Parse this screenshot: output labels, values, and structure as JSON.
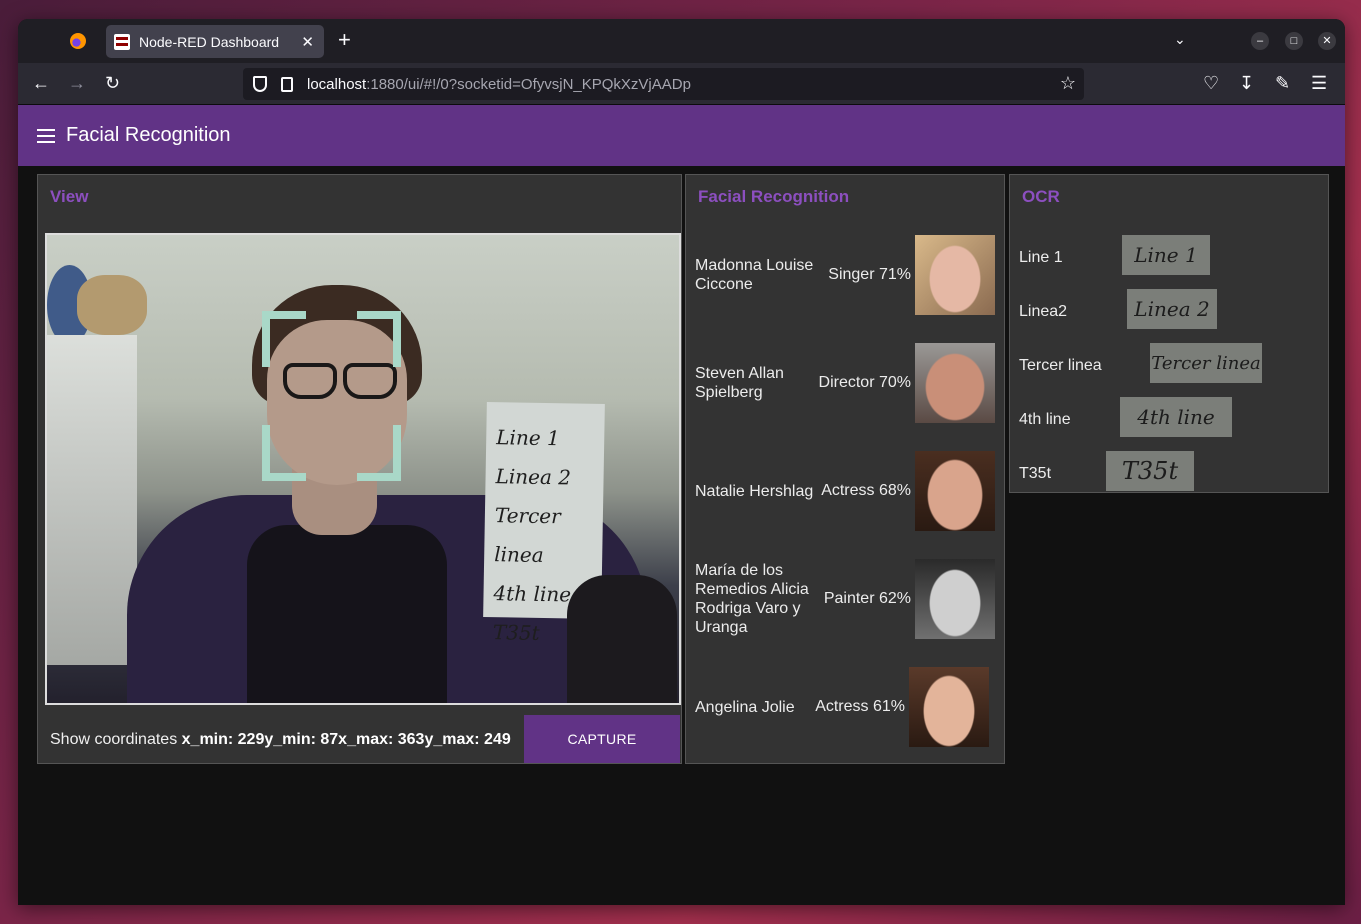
{
  "browser": {
    "tab_title": "Node-RED Dashboard",
    "tab_close": "✕",
    "new_tab": "+",
    "url_host": "localhost",
    "url_rest": ":1880/ui/#!/0?socketid=OfyvsjN_KPQkXzVjAADp"
  },
  "app": {
    "title": "Facial Recognition"
  },
  "view_card": {
    "title": "View",
    "paper_lines": [
      "Line 1",
      "Linea 2",
      "Tercer linea",
      "4th line",
      "T35t"
    ],
    "coords_label": "Show coordinates ",
    "coords_value": "x_min: 229y_min: 87x_max: 363y_max: 249",
    "capture_label": "CAPTURE"
  },
  "face_card": {
    "title": "Facial Recognition",
    "matches": [
      {
        "name": "Madonna Louise Ciccone",
        "role_pct": "Singer 71%",
        "skin": "#e5b8a5",
        "hair": "#d9b98a"
      },
      {
        "name": "Steven Allan Spielberg",
        "role_pct": "Director 70%",
        "skin": "#c98f78",
        "hair": "#9a9896"
      },
      {
        "name": "Natalie Hershlag",
        "role_pct": "Actress 68%",
        "skin": "#d9a48c",
        "hair": "#4a2e20"
      },
      {
        "name": "María de los Remedios Alicia Rodriga Varo y Uranga",
        "role_pct": "Painter 62%",
        "skin": "#cfcfcf",
        "hair": "#2a2a2a"
      },
      {
        "name": "Angelina Jolie",
        "role_pct": "Actress  61%",
        "skin": "#e3b49a",
        "hair": "#5a3a2a"
      }
    ]
  },
  "ocr_card": {
    "title": "OCR",
    "lines": [
      {
        "text": "Line 1",
        "crop": "Line 1"
      },
      {
        "text": "Linea2",
        "crop": "Linea 2"
      },
      {
        "text": "Tercer linea",
        "crop": "Tercer linea"
      },
      {
        "text": "4th line",
        "crop": "4th  line"
      },
      {
        "text": "T35t",
        "crop": "T35t"
      }
    ]
  },
  "colors": {
    "accent": "#613386",
    "title_purple": "#8c4fbf",
    "card_bg": "#333333",
    "page_bg": "#111111"
  }
}
